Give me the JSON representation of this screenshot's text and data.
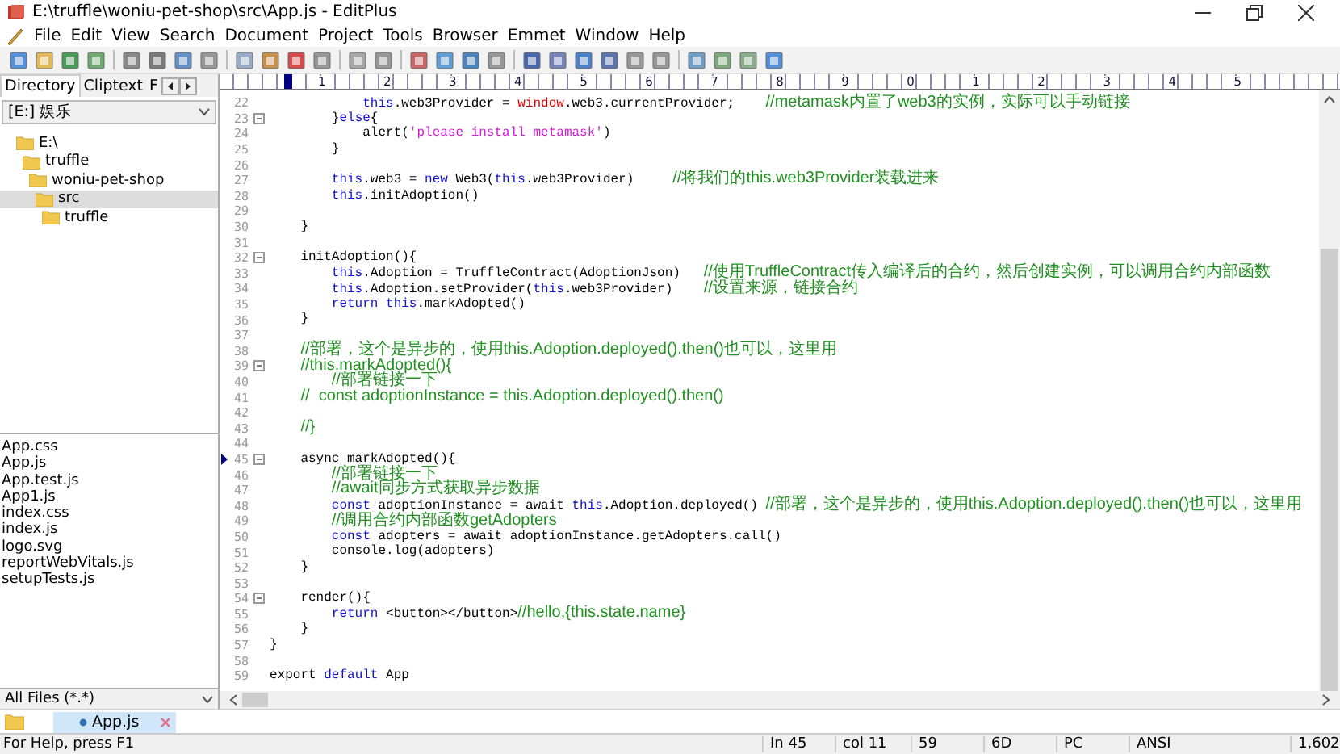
{
  "window": {
    "title": "E:\\truffle\\woniu-pet-shop\\src\\App.js - EditPlus"
  },
  "menu": [
    "File",
    "Edit",
    "View",
    "Search",
    "Document",
    "Project",
    "Tools",
    "Browser",
    "Emmet",
    "Window",
    "Help"
  ],
  "sidebar": {
    "tabs": [
      {
        "label": "Directory",
        "selected": true
      },
      {
        "label": "Cliptext",
        "selected": false
      },
      {
        "label": "F",
        "selected": false
      }
    ],
    "drive": "[E:] 娱乐",
    "tree": [
      {
        "name": "E:\\",
        "selected": false,
        "children": [
          {
            "name": "truffle",
            "selected": false,
            "children": [
              {
                "name": "woniu-pet-shop",
                "selected": false,
                "children": [
                  {
                    "name": "src",
                    "selected": true,
                    "children": [
                      {
                        "name": "truffle",
                        "selected": false
                      }
                    ]
                  }
                ]
              }
            ]
          }
        ]
      }
    ],
    "files": [
      "App.css",
      "App.js",
      "App.test.js",
      "App1.js",
      "index.css",
      "index.js",
      "logo.svg",
      "reportWebVitals.js",
      "setupTests.js"
    ],
    "filter": "All Files (*.*)"
  },
  "ruler": [
    "1",
    "2",
    "3",
    "4",
    "5",
    "6",
    "7",
    "8",
    "9",
    "0",
    "1",
    "2",
    "3",
    "4",
    "5"
  ],
  "lines": [
    {
      "num": "22",
      "fold": false,
      "current": false,
      "tokens": [
        {
          "kind": "kw",
          "text": "            this"
        },
        {
          "kind": "plain",
          "text": ".web3Provider = "
        },
        {
          "kind": "builtin",
          "text": "window"
        },
        {
          "kind": "plain",
          "text": ".web3.currentProvider;    "
        },
        {
          "kind": "comment",
          "text": "//metamask内置了web3的实例，实际可以手动链接"
        }
      ]
    },
    {
      "num": "23",
      "fold": true,
      "current": false,
      "tokens": [
        {
          "kind": "plain",
          "text": "        }"
        },
        {
          "kind": "kw",
          "text": "else"
        },
        {
          "kind": "plain",
          "text": "{"
        }
      ]
    },
    {
      "num": "24",
      "fold": false,
      "current": false,
      "tokens": [
        {
          "kind": "plain",
          "text": "            alert("
        },
        {
          "kind": "str",
          "text": "'please install metamask'"
        },
        {
          "kind": "plain",
          "text": ")"
        }
      ]
    },
    {
      "num": "25",
      "fold": false,
      "current": false,
      "tokens": [
        {
          "kind": "plain",
          "text": "        }"
        }
      ]
    },
    {
      "num": "26",
      "fold": false,
      "current": false
    },
    {
      "num": "27",
      "fold": false,
      "current": false,
      "tokens": [
        {
          "kind": "kw",
          "text": "        this"
        },
        {
          "kind": "plain",
          "text": ".web3 = "
        },
        {
          "kind": "kw",
          "text": "new"
        },
        {
          "kind": "plain",
          "text": " Web3("
        },
        {
          "kind": "kw",
          "text": "this"
        },
        {
          "kind": "plain",
          "text": ".web3Provider)     "
        },
        {
          "kind": "comment",
          "text": "//将我们的this.web3Provider装载进来"
        }
      ]
    },
    {
      "num": "28",
      "fold": false,
      "current": false,
      "tokens": [
        {
          "kind": "kw",
          "text": "        this"
        },
        {
          "kind": "plain",
          "text": ".initAdoption()"
        }
      ]
    },
    {
      "num": "29",
      "fold": false,
      "current": false
    },
    {
      "num": "30",
      "fold": false,
      "current": false,
      "tokens": [
        {
          "kind": "plain",
          "text": "    }"
        }
      ]
    },
    {
      "num": "31",
      "fold": false,
      "current": false
    },
    {
      "num": "32",
      "fold": true,
      "current": false,
      "tokens": [
        {
          "kind": "plain",
          "text": "    initAdoption(){"
        }
      ]
    },
    {
      "num": "33",
      "fold": false,
      "current": false,
      "tokens": [
        {
          "kind": "kw",
          "text": "        this"
        },
        {
          "kind": "plain",
          "text": ".Adoption = TruffleContract(AdoptionJson)   "
        },
        {
          "kind": "comment",
          "text": "//使用TruffleContract传入编译后的合约，然后创建实例，可以调用合约内部函数"
        }
      ]
    },
    {
      "num": "34",
      "fold": false,
      "current": false,
      "tokens": [
        {
          "kind": "kw",
          "text": "        this"
        },
        {
          "kind": "plain",
          "text": ".Adoption.setProvider("
        },
        {
          "kind": "kw",
          "text": "this"
        },
        {
          "kind": "plain",
          "text": ".web3Provider)    "
        },
        {
          "kind": "comment",
          "text": "//设置来源，链接合约"
        }
      ]
    },
    {
      "num": "35",
      "fold": false,
      "current": false,
      "tokens": [
        {
          "kind": "kw",
          "text": "        return this"
        },
        {
          "kind": "plain",
          "text": ".markAdopted()"
        }
      ]
    },
    {
      "num": "36",
      "fold": false,
      "current": false,
      "tokens": [
        {
          "kind": "plain",
          "text": "    }"
        }
      ]
    },
    {
      "num": "37",
      "fold": false,
      "current": false
    },
    {
      "num": "38",
      "fold": false,
      "current": false,
      "tokens": [
        {
          "kind": "comment",
          "text": "    //部署，这个是异步的，使用this.Adoption.deployed().then()也可以，这里用"
        }
      ]
    },
    {
      "num": "39",
      "fold": true,
      "current": false,
      "tokens": [
        {
          "kind": "comment",
          "text": "    //this.markAdopted(){"
        }
      ]
    },
    {
      "num": "40",
      "fold": false,
      "current": false,
      "tokens": [
        {
          "kind": "comment",
          "text": "        //部署链接一下"
        }
      ]
    },
    {
      "num": "41",
      "fold": false,
      "current": false,
      "tokens": [
        {
          "kind": "comment",
          "text": "    //  const adoptionInstance = this.Adoption.deployed().then()"
        }
      ]
    },
    {
      "num": "42",
      "fold": false,
      "current": false
    },
    {
      "num": "43",
      "fold": false,
      "current": false,
      "tokens": [
        {
          "kind": "comment",
          "text": "    //}"
        }
      ]
    },
    {
      "num": "44",
      "fold": false,
      "current": false
    },
    {
      "num": "45",
      "fold": true,
      "current": true,
      "tokens": [
        {
          "kind": "plain",
          "text": "    async markAdopted(){"
        }
      ]
    },
    {
      "num": "46",
      "fold": false,
      "current": false,
      "tokens": [
        {
          "kind": "comment",
          "text": "        //部署链接一下"
        }
      ]
    },
    {
      "num": "47",
      "fold": false,
      "current": false,
      "tokens": [
        {
          "kind": "comment",
          "text": "        //await同步方式获取异步数据"
        }
      ]
    },
    {
      "num": "48",
      "fold": false,
      "current": false,
      "tokens": [
        {
          "kind": "kw",
          "text": "        const"
        },
        {
          "kind": "plain",
          "text": " adoptionInstance = await "
        },
        {
          "kind": "kw",
          "text": "this"
        },
        {
          "kind": "plain",
          "text": ".Adoption.deployed() "
        },
        {
          "kind": "comment",
          "text": "//部署，这个是异步的，使用this.Adoption.deployed().then()也可以，这里用"
        }
      ]
    },
    {
      "num": "49",
      "fold": false,
      "current": false,
      "tokens": [
        {
          "kind": "comment",
          "text": "        //调用合约内部函数getAdopters"
        }
      ]
    },
    {
      "num": "50",
      "fold": false,
      "current": false,
      "tokens": [
        {
          "kind": "kw",
          "text": "        const"
        },
        {
          "kind": "plain",
          "text": " adopters = await adoptionInstance.getAdopters.call()"
        }
      ]
    },
    {
      "num": "51",
      "fold": false,
      "current": false,
      "tokens": [
        {
          "kind": "plain",
          "text": "        console.log(adopters)"
        }
      ]
    },
    {
      "num": "52",
      "fold": false,
      "current": false,
      "tokens": [
        {
          "kind": "plain",
          "text": "    }"
        }
      ]
    },
    {
      "num": "53",
      "fold": false,
      "current": false
    },
    {
      "num": "54",
      "fold": true,
      "current": false,
      "tokens": [
        {
          "kind": "plain",
          "text": "    render(){"
        }
      ]
    },
    {
      "num": "55",
      "fold": false,
      "current": false,
      "tokens": [
        {
          "kind": "kw",
          "text": "        return"
        },
        {
          "kind": "plain",
          "text": " <button></button>"
        },
        {
          "kind": "comment",
          "text": "//hello,{this.state.name}"
        }
      ]
    },
    {
      "num": "56",
      "fold": false,
      "current": false,
      "tokens": [
        {
          "kind": "plain",
          "text": "    }"
        }
      ]
    },
    {
      "num": "57",
      "fold": false,
      "current": false,
      "tokens": [
        {
          "kind": "plain",
          "text": "}"
        }
      ]
    },
    {
      "num": "58",
      "fold": false,
      "current": false
    },
    {
      "num": "59",
      "fold": false,
      "current": false,
      "tokens": [
        {
          "kind": "plain",
          "text": "export "
        },
        {
          "kind": "kw",
          "text": "default"
        },
        {
          "kind": "plain",
          "text": " App"
        }
      ]
    }
  ],
  "doc_tabs": [
    {
      "label": "App.js",
      "selected": true
    }
  ],
  "status_bar": {
    "help": "For Help, press F1",
    "fields": [
      "In 45",
      "col 11",
      "59",
      "6D",
      "PC",
      "ANSI",
      "1,602"
    ]
  }
}
